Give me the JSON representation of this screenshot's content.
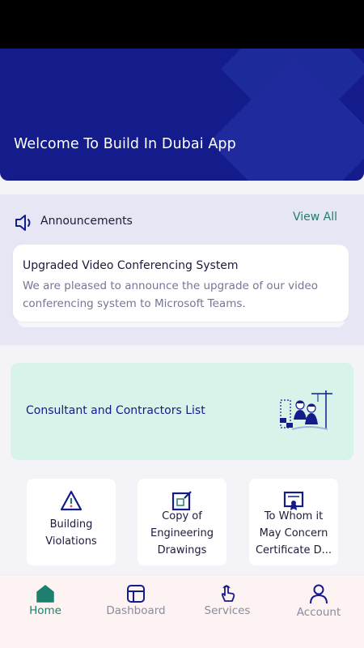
{
  "hero": {
    "title": "Welcome To Build In Dubai App"
  },
  "announcements": {
    "title": "Announcements",
    "view_all": "View All",
    "card": {
      "title": "Upgraded Video Conferencing System",
      "body": "We are pleased to announce the upgrade of our video conferencing system to Microsoft Teams."
    }
  },
  "consultant": {
    "label": "Consultant and Contractors List"
  },
  "services": [
    {
      "line1": "Building",
      "line2": "Violations",
      "line3": ""
    },
    {
      "line1": "Copy of",
      "line2": "Engineering",
      "line3": "Drawings"
    },
    {
      "line1": "To Whom it",
      "line2": "May Concern",
      "line3": "Certificate D..."
    }
  ],
  "nav": [
    {
      "label": "Home",
      "active": true
    },
    {
      "label": "Dashboard",
      "active": false
    },
    {
      "label": "Services",
      "active": false
    },
    {
      "label": "Account",
      "active": false
    }
  ],
  "colors": {
    "primary": "#141c8c",
    "accent": "#1f7f6e",
    "mint": "#d7f3ea"
  }
}
